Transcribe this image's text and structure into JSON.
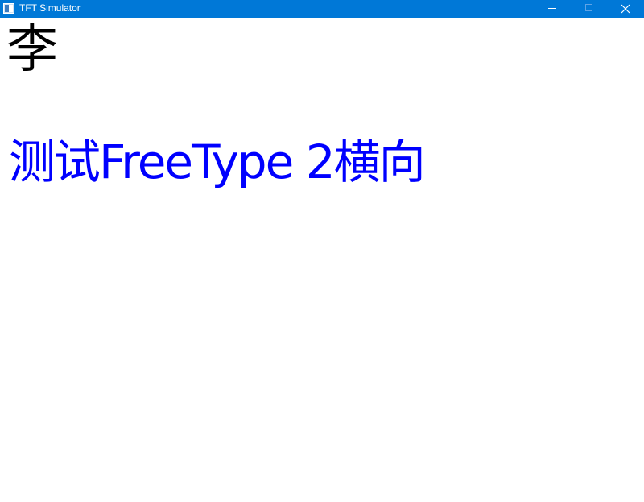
{
  "window": {
    "title": "TFT Simulator",
    "controls": {
      "minimize": "minimize-icon",
      "maximize": "maximize-icon",
      "close": "close-icon"
    },
    "titlebar_color": "#0078d7"
  },
  "canvas": {
    "single_char": "李",
    "single_char_color": "#000000",
    "test_text": "测试FreeType 2横向",
    "test_text_color": "#0000ff",
    "background": "#ffffff"
  }
}
